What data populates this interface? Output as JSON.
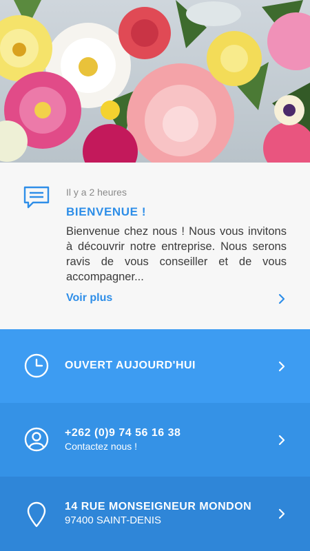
{
  "hero": {
    "image": "flowers-bouquet-photo"
  },
  "message": {
    "icon": "chat-message-icon",
    "timestamp": "Il y a 2 heures",
    "title": "BIENVENUE !",
    "body": "Bienvenue chez nous ! Nous vous invitons à découvrir notre entreprise. Nous serons ravis de vous conseiller et de vous accompagner...",
    "link_label": "Voir plus",
    "accent": "#2e8ee8"
  },
  "rows": [
    {
      "icon": "clock-icon",
      "title": "OUVERT AUJOURD'HUI",
      "subtitle": "",
      "color": "#3d9cf2"
    },
    {
      "icon": "user-icon",
      "title": "+262 (0)9 74 56 16 38",
      "subtitle": "Contactez nous !",
      "color": "#3592e6"
    },
    {
      "icon": "location-pin-icon",
      "title": "14 RUE MONSEIGNEUR MONDON",
      "subtitle": "97400 SAINT-DENIS",
      "color": "#2f86d8"
    }
  ]
}
